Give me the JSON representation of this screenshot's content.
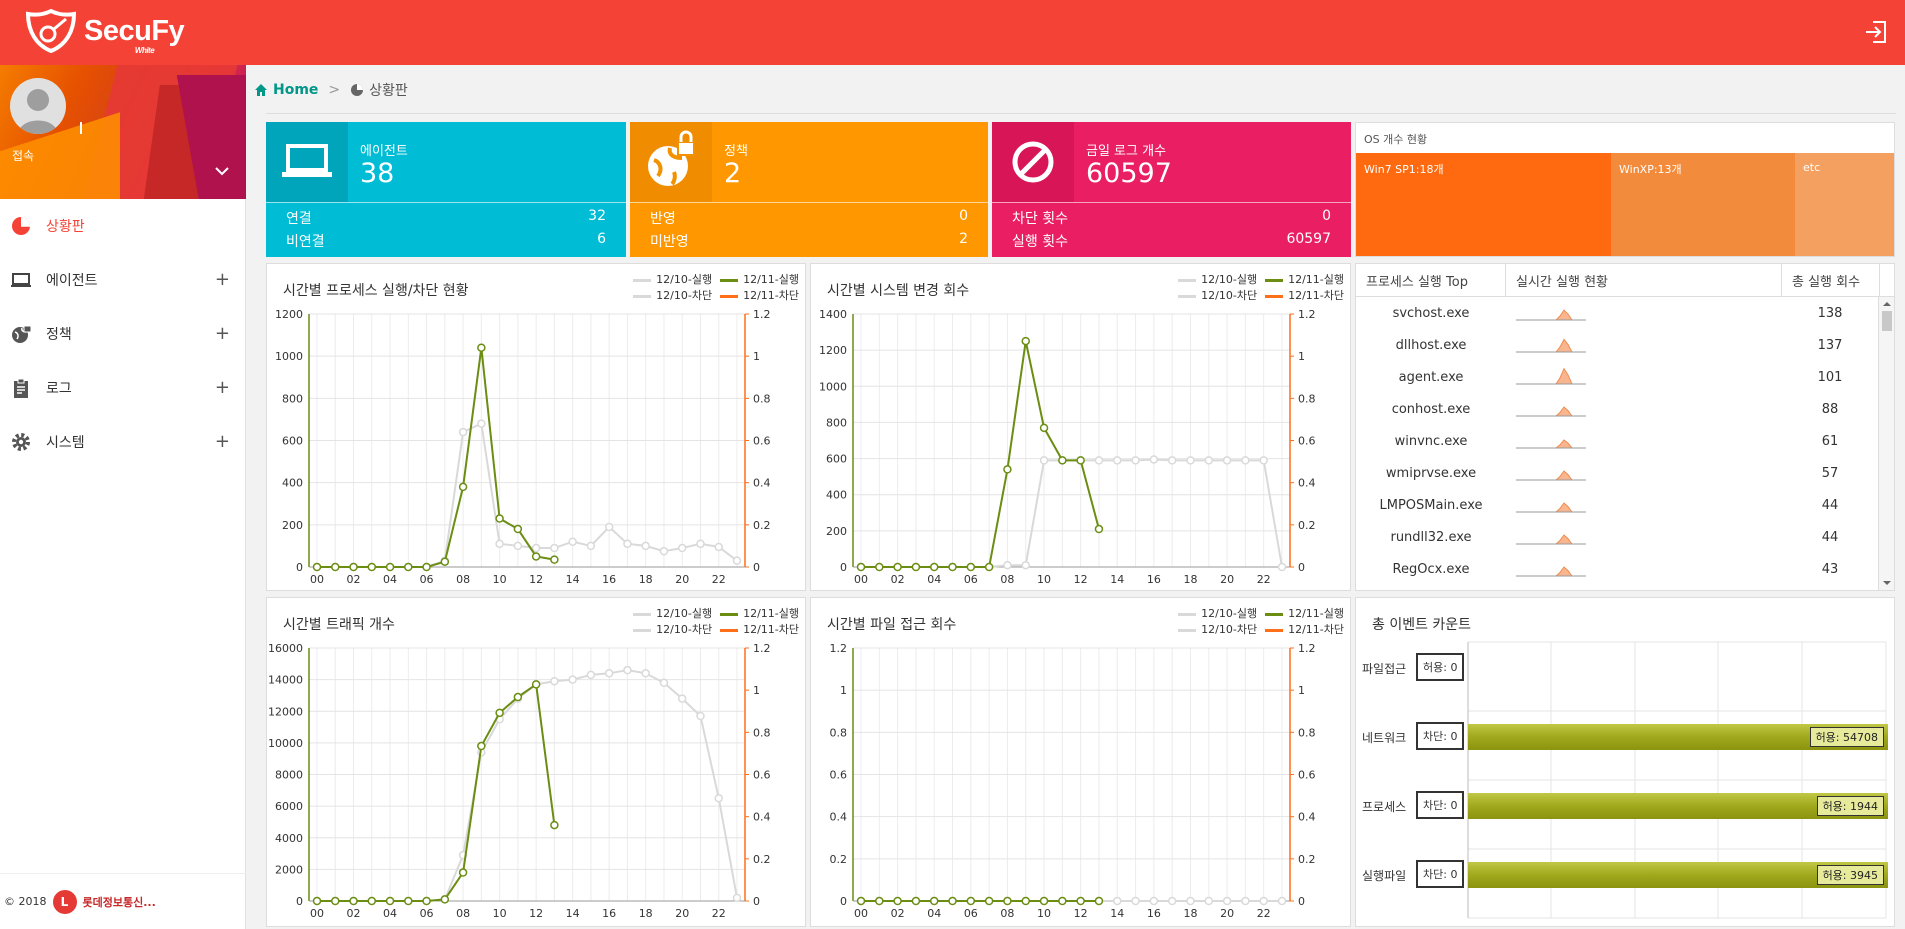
{
  "app": {
    "name": "SecuFy",
    "edition": "White"
  },
  "profile": {
    "status": "접속"
  },
  "menu": [
    {
      "label": "상황판",
      "icon": "dashboard-icon",
      "active": true
    },
    {
      "label": "에이전트",
      "icon": "laptop-icon",
      "expand": "+"
    },
    {
      "label": "정책",
      "icon": "globe-lock-icon",
      "expand": "+"
    },
    {
      "label": "로그",
      "icon": "clipboard-icon",
      "expand": "+"
    },
    {
      "label": "시스템",
      "icon": "gear-icon",
      "expand": "+"
    }
  ],
  "footer": {
    "year": "© 2018",
    "company": "롯데정보통신..."
  },
  "breadcrumb": {
    "home": "Home",
    "sep": ">",
    "current": "상황판"
  },
  "cards": {
    "agent": {
      "title": "에이전트",
      "value": "38",
      "color": "#00bcd4",
      "dark": "#00a5bb",
      "rows": [
        {
          "label": "연결",
          "value": "32"
        },
        {
          "label": "비연결",
          "value": "6"
        }
      ]
    },
    "policy": {
      "title": "정책",
      "value": "2",
      "color": "#ff9800",
      "dark": "#f08c00",
      "rows": [
        {
          "label": "반영",
          "value": "0"
        },
        {
          "label": "미반영",
          "value": "2"
        }
      ]
    },
    "log": {
      "title": "금일 로그 개수",
      "value": "60597",
      "color": "#e91e63",
      "dark": "#d81657",
      "rows": [
        {
          "label": "차단 횟수",
          "value": "0"
        },
        {
          "label": "실행 횟수",
          "value": "60597"
        }
      ]
    }
  },
  "os": {
    "title": "OS 개수 현황",
    "segments": [
      {
        "label": "Win7 SP1:18개",
        "count": 18,
        "color": "#ff6a10"
      },
      {
        "label": "WinXP:13개",
        "count": 13,
        "color": "#f28c3c"
      },
      {
        "label": "etc",
        "count": 7,
        "color": "#f4a060"
      }
    ]
  },
  "legend": {
    "a": "12/10-실행",
    "b": "12/11-실행",
    "c": "12/10-차단",
    "d": "12/11-차단"
  },
  "colors": {
    "day10": "#d9d9d9",
    "day11": "#6a8d12",
    "block11": "#ff6f1a",
    "axisLeft": "#6a8d12",
    "axisRight": "#ff6f1a"
  },
  "chart_data": [
    {
      "type": "line",
      "title": "시간별 프로세스 실행/차단 현황",
      "x": [
        "00",
        "01",
        "02",
        "03",
        "04",
        "05",
        "06",
        "07",
        "08",
        "09",
        "10",
        "11",
        "12",
        "13",
        "14",
        "15",
        "16",
        "17",
        "18",
        "19",
        "20",
        "21",
        "22",
        "23"
      ],
      "ylim": [
        0,
        1200
      ],
      "yticks": [
        0,
        200,
        400,
        600,
        800,
        1000,
        1200
      ],
      "y2lim": [
        0,
        1.2
      ],
      "y2ticks": [
        0,
        0.2,
        0.4,
        0.6,
        0.8,
        1,
        1.2
      ],
      "series": [
        {
          "name": "12/10-실행",
          "values": [
            0,
            0,
            0,
            0,
            0,
            0,
            0,
            30,
            640,
            680,
            110,
            100,
            90,
            90,
            120,
            100,
            190,
            110,
            100,
            75,
            90,
            110,
            95,
            30
          ]
        },
        {
          "name": "12/11-실행",
          "values": [
            0,
            0,
            0,
            0,
            0,
            0,
            0,
            25,
            380,
            1040,
            230,
            180,
            50,
            35
          ]
        },
        {
          "name": "12/10-차단",
          "values": []
        },
        {
          "name": "12/11-차단",
          "values": []
        }
      ]
    },
    {
      "type": "line",
      "title": "시간별 시스템 변경 회수",
      "x": [
        "00",
        "01",
        "02",
        "03",
        "04",
        "05",
        "06",
        "07",
        "08",
        "09",
        "10",
        "11",
        "12",
        "13",
        "14",
        "15",
        "16",
        "17",
        "18",
        "19",
        "20",
        "21",
        "22",
        "23"
      ],
      "ylim": [
        0,
        1400
      ],
      "yticks": [
        0,
        200,
        400,
        600,
        800,
        1000,
        1200,
        1400
      ],
      "y2lim": [
        0,
        1.2
      ],
      "y2ticks": [
        0,
        0.2,
        0.4,
        0.6,
        0.8,
        1,
        1.2
      ],
      "series": [
        {
          "name": "12/10-실행",
          "values": [
            0,
            0,
            0,
            0,
            0,
            0,
            0,
            0,
            10,
            10,
            590,
            590,
            590,
            590,
            590,
            590,
            595,
            590,
            590,
            590,
            590,
            590,
            590,
            0
          ]
        },
        {
          "name": "12/11-실행",
          "values": [
            0,
            0,
            0,
            0,
            0,
            0,
            0,
            0,
            540,
            1250,
            770,
            590,
            590,
            210
          ]
        },
        {
          "name": "12/10-차단",
          "values": []
        },
        {
          "name": "12/11-차단",
          "values": []
        }
      ]
    },
    {
      "type": "line",
      "title": "시간별 트래픽 개수",
      "x": [
        "00",
        "01",
        "02",
        "03",
        "04",
        "05",
        "06",
        "07",
        "08",
        "09",
        "10",
        "11",
        "12",
        "13",
        "14",
        "15",
        "16",
        "17",
        "18",
        "19",
        "20",
        "21",
        "22",
        "23"
      ],
      "ylim": [
        0,
        16000
      ],
      "yticks": [
        0,
        2000,
        4000,
        6000,
        8000,
        10000,
        12000,
        14000,
        16000
      ],
      "y2lim": [
        0,
        1.2
      ],
      "y2ticks": [
        0,
        0.2,
        0.4,
        0.6,
        0.8,
        1,
        1.2
      ],
      "series": [
        {
          "name": "12/10-실행",
          "values": [
            0,
            0,
            0,
            0,
            0,
            0,
            0,
            100,
            2900,
            9400,
            11500,
            12800,
            13700,
            13900,
            14000,
            14300,
            14400,
            14600,
            14400,
            13800,
            12800,
            11700,
            6500,
            200
          ]
        },
        {
          "name": "12/11-실행",
          "values": [
            0,
            0,
            0,
            0,
            0,
            0,
            0,
            100,
            1800,
            9800,
            11900,
            12900,
            13700,
            4800
          ]
        },
        {
          "name": "12/10-차단",
          "values": []
        },
        {
          "name": "12/11-차단",
          "values": []
        }
      ]
    },
    {
      "type": "line",
      "title": "시간별 파일 접근 회수",
      "x": [
        "00",
        "01",
        "02",
        "03",
        "04",
        "05",
        "06",
        "07",
        "08",
        "09",
        "10",
        "11",
        "12",
        "13",
        "14",
        "15",
        "16",
        "17",
        "18",
        "19",
        "20",
        "21",
        "22",
        "23"
      ],
      "ylim": [
        0,
        1.2
      ],
      "yticks": [
        0,
        0.2,
        0.4,
        0.6,
        0.8,
        1,
        1.2
      ],
      "y2lim": [
        0,
        1.2
      ],
      "y2ticks": [
        0,
        0.2,
        0.4,
        0.6,
        0.8,
        1,
        1.2
      ],
      "series": [
        {
          "name": "12/10-실행",
          "values": [
            0,
            0,
            0,
            0,
            0,
            0,
            0,
            0,
            0,
            0,
            0,
            0,
            0,
            0,
            0,
            0,
            0,
            0,
            0,
            0,
            0,
            0,
            0,
            0
          ]
        },
        {
          "name": "12/11-실행",
          "values": [
            0,
            0,
            0,
            0,
            0,
            0,
            0,
            0,
            0,
            0,
            0,
            0,
            0,
            0
          ]
        },
        {
          "name": "12/10-차단",
          "values": []
        },
        {
          "name": "12/11-차단",
          "values": []
        }
      ]
    }
  ],
  "process_table": {
    "headers": [
      "프로세스 실행 Top",
      "실시간 실행 현황",
      "총 실행 회수"
    ],
    "rows": [
      {
        "name": "svchost.exe",
        "count": "138",
        "peak": 0.55
      },
      {
        "name": "dllhost.exe",
        "count": "137",
        "peak": 0.7
      },
      {
        "name": "agent.exe",
        "count": "101",
        "peak": 0.85
      },
      {
        "name": "conhost.exe",
        "count": "88",
        "peak": 0.5
      },
      {
        "name": "winvnc.exe",
        "count": "61",
        "peak": 0.45
      },
      {
        "name": "wmiprvse.exe",
        "count": "57",
        "peak": 0.5
      },
      {
        "name": "LMPOSMain.exe",
        "count": "44",
        "peak": 0.5
      },
      {
        "name": "rundll32.exe",
        "count": "44",
        "peak": 0.5
      },
      {
        "name": "RegOcx.exe",
        "count": "43",
        "peak": 0.5
      }
    ]
  },
  "events": {
    "title": "총 이벤트 카운트",
    "rows": [
      {
        "label": "파일접근",
        "badge": "허용: 0",
        "bar": ""
      },
      {
        "label": "네트워크",
        "badge": "차단: 0",
        "bar": "허용:  54708"
      },
      {
        "label": "프로세스",
        "badge": "차단: 0",
        "bar": "허용:  1944"
      },
      {
        "label": "실행파일",
        "badge": "차단: 0",
        "bar": "허용:  3945"
      }
    ]
  }
}
